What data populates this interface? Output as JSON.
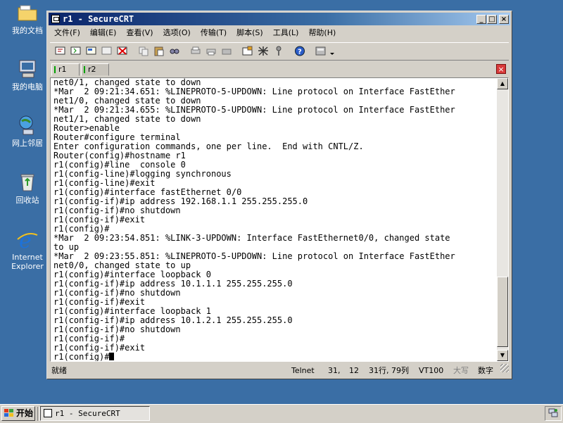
{
  "desktop": {
    "icons": [
      {
        "label": "我的文档"
      },
      {
        "label": "我的电脑"
      },
      {
        "label": "网上邻居"
      },
      {
        "label": "回收站"
      },
      {
        "label": "Internet Explorer"
      }
    ]
  },
  "window": {
    "title": "r1 - SecureCRT",
    "minimize_glyph": "_",
    "maximize_glyph": "□",
    "close_glyph": "×"
  },
  "menu": {
    "items": [
      "文件(F)",
      "编辑(E)",
      "查看(V)",
      "选项(O)",
      "传输(T)",
      "脚本(S)",
      "工具(L)",
      "帮助(H)"
    ]
  },
  "toolbar": {
    "buttons": [
      "connect-icon",
      "quick-connect-icon",
      "connect-tab-icon",
      "reconnect-icon",
      "disconnect-icon",
      "copy-icon",
      "paste-icon",
      "find-icon",
      "print-icon",
      "print-setup-icon",
      "print-screen-icon",
      "session-options-icon",
      "global-options-icon",
      "keymap-icon",
      "help-icon",
      "sftp-icon"
    ]
  },
  "tabs": [
    {
      "label": "r1",
      "active": true
    },
    {
      "label": "r2",
      "active": false
    }
  ],
  "tab_close_glyph": "×",
  "terminal": {
    "lines": [
      "net0/1, changed state to down",
      "*Mar  2 09:21:34.651: %LINEPROTO-5-UPDOWN: Line protocol on Interface FastEther",
      "net1/0, changed state to down",
      "*Mar  2 09:21:34.655: %LINEPROTO-5-UPDOWN: Line protocol on Interface FastEther",
      "net1/1, changed state to down",
      "Router>enable",
      "Router#configure terminal",
      "Enter configuration commands, one per line.  End with CNTL/Z.",
      "Router(config)#hostname r1",
      "r1(config)#line  console 0",
      "r1(config-line)#logging synchronous",
      "r1(config-line)#exit",
      "r1(config)#interface fastEthernet 0/0",
      "r1(config-if)#ip address 192.168.1.1 255.255.255.0",
      "r1(config-if)#no shutdown",
      "r1(config-if)#exit",
      "r1(config)#",
      "*Mar  2 09:23:54.851: %LINK-3-UPDOWN: Interface FastEthernet0/0, changed state",
      "to up",
      "*Mar  2 09:23:55.851: %LINEPROTO-5-UPDOWN: Line protocol on Interface FastEther",
      "net0/0, changed state to up",
      "r1(config)#interface loopback 0",
      "r1(config-if)#ip address 10.1.1.1 255.255.255.0",
      "r1(config-if)#no shutdown",
      "r1(config-if)#exit",
      "r1(config)#interface loopback 1",
      "r1(config-if)#ip address 10.1.2.1 255.255.255.0",
      "r1(config-if)#no shutdown",
      "r1(config-if)#",
      "r1(config-if)#exit"
    ],
    "prompt": "r1(config)#"
  },
  "statusbar": {
    "ready": "就绪",
    "protocol": "Telnet",
    "row": "31,",
    "col": "12",
    "position": "31行, 79列",
    "emulation": "VT100",
    "caps": "大写",
    "num": "数字"
  },
  "taskbar": {
    "start_label": "开始",
    "task_label": "r1 - SecureCRT"
  }
}
